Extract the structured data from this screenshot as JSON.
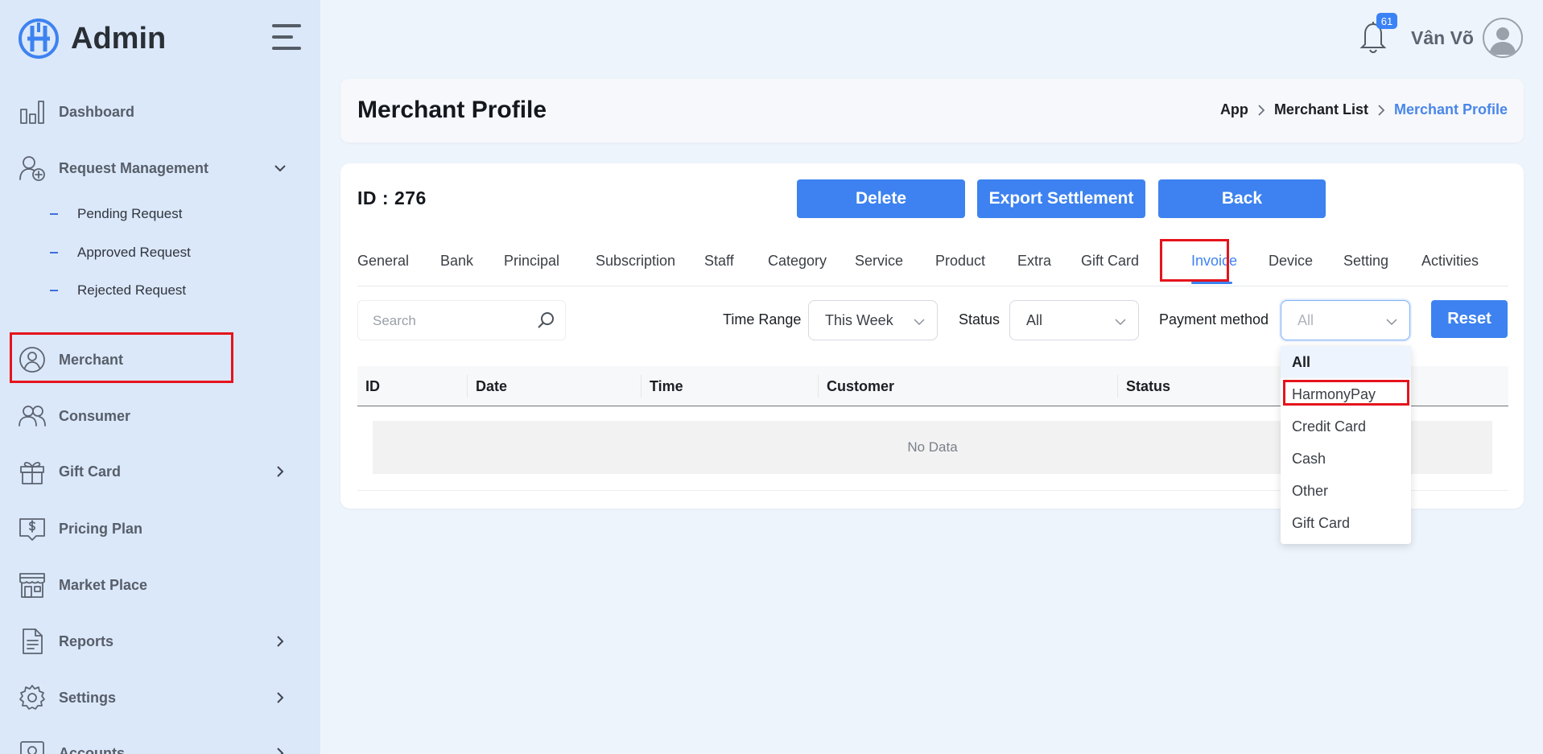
{
  "app": {
    "title": "Admin"
  },
  "sidebar": {
    "items": [
      {
        "label": "Dashboard"
      },
      {
        "label": "Request Management"
      },
      {
        "label": "Merchant"
      },
      {
        "label": "Consumer"
      },
      {
        "label": "Gift Card"
      },
      {
        "label": "Pricing Plan"
      },
      {
        "label": "Market Place"
      },
      {
        "label": "Reports"
      },
      {
        "label": "Settings"
      },
      {
        "label": "Accounts"
      }
    ],
    "sub_items": [
      {
        "label": "Pending Request"
      },
      {
        "label": "Approved Request"
      },
      {
        "label": "Rejected Request"
      }
    ]
  },
  "topbar": {
    "notification_count": "61",
    "user_name": "Vân Võ"
  },
  "header": {
    "title": "Merchant Profile",
    "breadcrumb": [
      "App",
      "Merchant List",
      "Merchant Profile"
    ]
  },
  "profile": {
    "id_label": "ID : 276",
    "buttons": {
      "delete": "Delete",
      "export": "Export Settlement",
      "back": "Back"
    }
  },
  "tabs": [
    {
      "label": "General"
    },
    {
      "label": "Bank"
    },
    {
      "label": "Principal"
    },
    {
      "label": "Subscription"
    },
    {
      "label": "Staff"
    },
    {
      "label": "Category"
    },
    {
      "label": "Service"
    },
    {
      "label": "Product"
    },
    {
      "label": "Extra"
    },
    {
      "label": "Gift Card"
    },
    {
      "label": "Invoice",
      "active": true
    },
    {
      "label": "Device"
    },
    {
      "label": "Setting"
    },
    {
      "label": "Activities"
    }
  ],
  "filters": {
    "search_placeholder": "Search",
    "time_range_label": "Time Range",
    "time_range_value": "This Week",
    "status_label": "Status",
    "status_value": "All",
    "payment_label": "Payment method",
    "payment_value": "All",
    "reset_label": "Reset"
  },
  "table": {
    "columns": [
      "ID",
      "Date",
      "Time",
      "Customer",
      "Status"
    ],
    "empty_text": "No Data"
  },
  "payment_dropdown": {
    "options": [
      "All",
      "HarmonyPay",
      "Credit Card",
      "Cash",
      "Other",
      "Gift Card"
    ],
    "selected": "All"
  },
  "colors": {
    "accent": "#3d82f0",
    "sidebar_bg": "#dbe8fa",
    "page_bg": "#eef4fc",
    "highlight": "#e5141c"
  }
}
